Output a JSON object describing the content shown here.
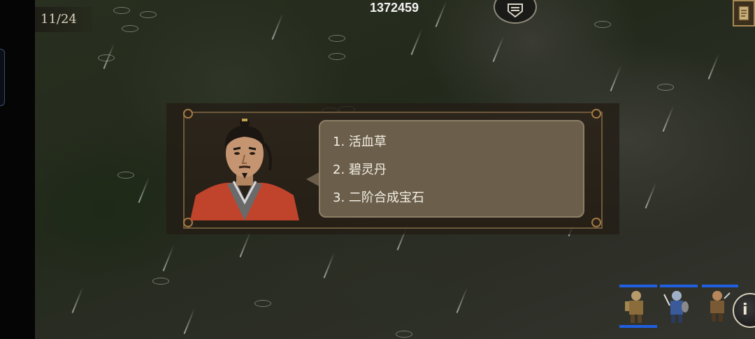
{
  "hud": {
    "turn": "11/24",
    "gold": "1372459"
  },
  "dialog": {
    "options": [
      {
        "label": "1. 活血草"
      },
      {
        "label": "2. 碧灵丹"
      },
      {
        "label": "3. 二阶合成宝石"
      }
    ]
  },
  "units": [
    {
      "icon": "armored-warrior-icon"
    },
    {
      "icon": "blue-soldier-icon"
    },
    {
      "icon": "bandit-warrior-icon"
    }
  ],
  "icons": {
    "top_emblem": "shield-emblem-icon",
    "corner_button": "menu-scroll-icon",
    "info_button": "info-icon"
  },
  "colors": {
    "hp_bar": "#1f5fe0",
    "dialog_bubble": "#6b5f4c",
    "dialog_border": "#a27a45"
  }
}
